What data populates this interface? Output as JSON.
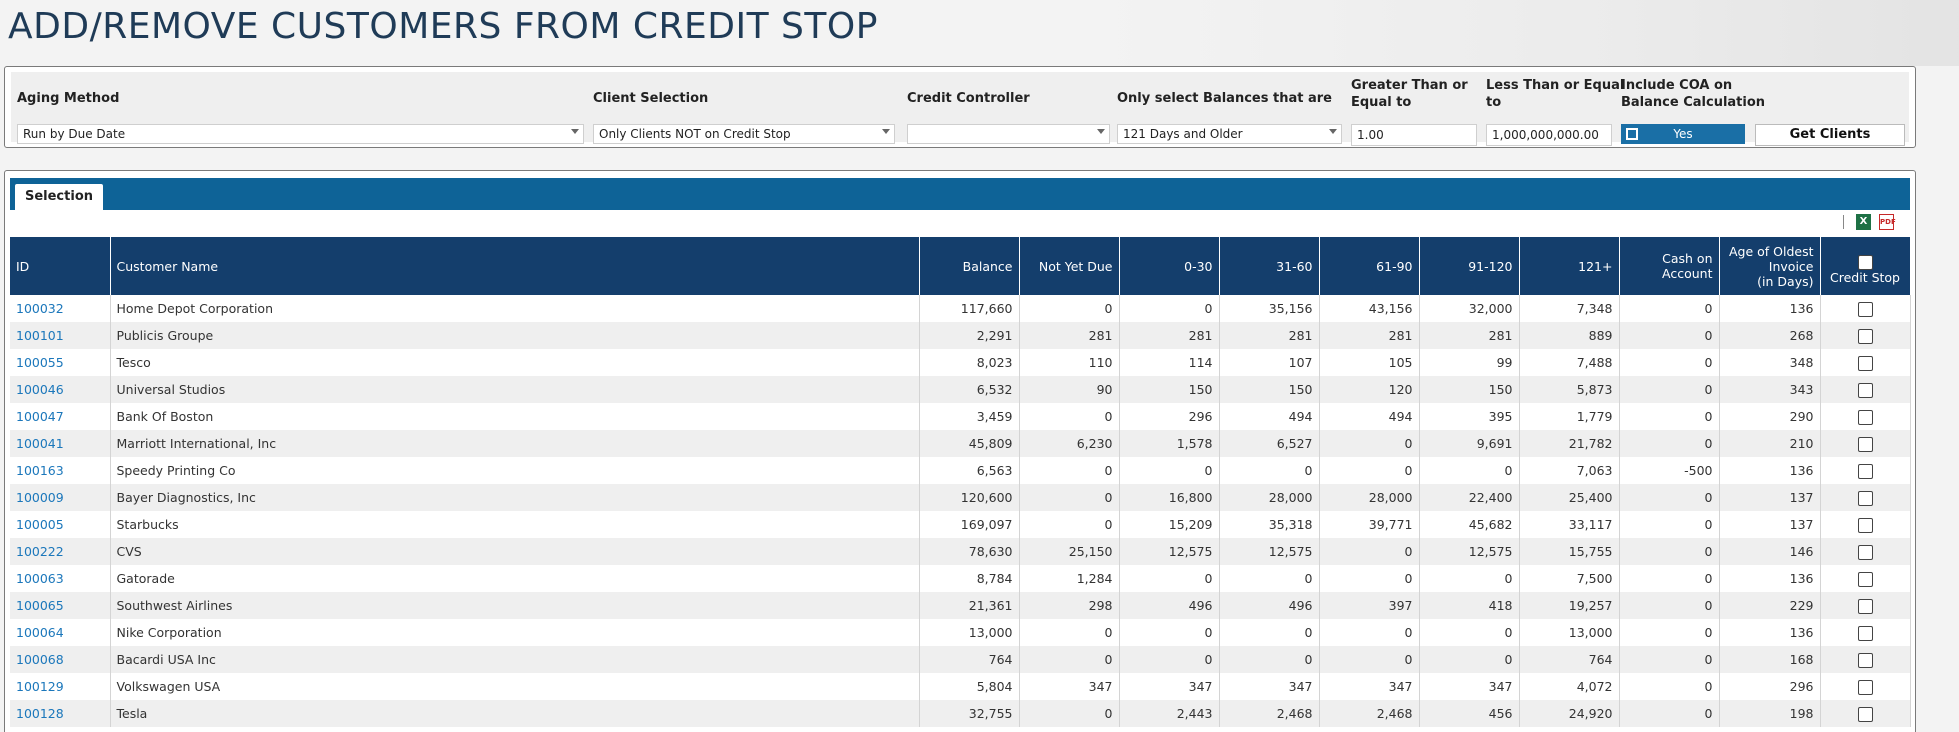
{
  "page": {
    "title": "ADD/REMOVE CUSTOMERS FROM CREDIT STOP"
  },
  "filters": {
    "aging_method": {
      "label": "Aging Method",
      "value": "Run by Due Date"
    },
    "client_selection": {
      "label": "Client Selection",
      "value": "Only Clients NOT on Credit Stop"
    },
    "credit_controller": {
      "label": "Credit Controller",
      "value": ""
    },
    "balances": {
      "label": "Only select Balances that are",
      "value": "121 Days and Older"
    },
    "greater_than": {
      "label_1": "Greater Than or",
      "label_2": "Equal to",
      "value": "1.00"
    },
    "less_than": {
      "label_1": "Less Than or Equal",
      "label_2": "to",
      "value": "1,000,000,000.00"
    },
    "include_coa": {
      "label_1": "Include COA on",
      "label_2": "Balance Calculation",
      "value": "Yes"
    },
    "get_clients_label": "Get Clients"
  },
  "grid": {
    "tab_label": "Selection",
    "icons": {
      "excel": "excel-export-icon",
      "pdf": "pdf-export-icon",
      "excel_glyph": "X",
      "pdf_glyph": "PDF"
    },
    "columns": {
      "id": "ID",
      "name": "Customer Name",
      "balance": "Balance",
      "not_yet_due": "Not Yet Due",
      "b0_30": "0-30",
      "b31_60": "31-60",
      "b61_90": "61-90",
      "b91_120": "91-120",
      "b121": "121+",
      "coa_1": "Cash on",
      "coa_2": "Account",
      "age_1": "Age of Oldest",
      "age_2": "Invoice",
      "age_3": "(in Days)",
      "credit_stop": "Credit Stop"
    },
    "rows": [
      {
        "id": "100032",
        "name": "Home Depot Corporation",
        "balance": "117,660",
        "nyd": "0",
        "b0_30": "0",
        "b31_60": "35,156",
        "b61_90": "43,156",
        "b91_120": "32,000",
        "b121": "7,348",
        "coa": "0",
        "age": "136"
      },
      {
        "id": "100101",
        "name": "Publicis Groupe",
        "balance": "2,291",
        "nyd": "281",
        "b0_30": "281",
        "b31_60": "281",
        "b61_90": "281",
        "b91_120": "281",
        "b121": "889",
        "coa": "0",
        "age": "268"
      },
      {
        "id": "100055",
        "name": "Tesco",
        "balance": "8,023",
        "nyd": "110",
        "b0_30": "114",
        "b31_60": "107",
        "b61_90": "105",
        "b91_120": "99",
        "b121": "7,488",
        "coa": "0",
        "age": "348"
      },
      {
        "id": "100046",
        "name": "Universal Studios",
        "balance": "6,532",
        "nyd": "90",
        "b0_30": "150",
        "b31_60": "150",
        "b61_90": "120",
        "b91_120": "150",
        "b121": "5,873",
        "coa": "0",
        "age": "343"
      },
      {
        "id": "100047",
        "name": "Bank Of Boston",
        "balance": "3,459",
        "nyd": "0",
        "b0_30": "296",
        "b31_60": "494",
        "b61_90": "494",
        "b91_120": "395",
        "b121": "1,779",
        "coa": "0",
        "age": "290"
      },
      {
        "id": "100041",
        "name": "Marriott International, Inc",
        "balance": "45,809",
        "nyd": "6,230",
        "b0_30": "1,578",
        "b31_60": "6,527",
        "b61_90": "0",
        "b91_120": "9,691",
        "b121": "21,782",
        "coa": "0",
        "age": "210"
      },
      {
        "id": "100163",
        "name": "Speedy Printing Co",
        "balance": "6,563",
        "nyd": "0",
        "b0_30": "0",
        "b31_60": "0",
        "b61_90": "0",
        "b91_120": "0",
        "b121": "7,063",
        "coa": "-500",
        "age": "136"
      },
      {
        "id": "100009",
        "name": "Bayer Diagnostics, Inc",
        "balance": "120,600",
        "nyd": "0",
        "b0_30": "16,800",
        "b31_60": "28,000",
        "b61_90": "28,000",
        "b91_120": "22,400",
        "b121": "25,400",
        "coa": "0",
        "age": "137"
      },
      {
        "id": "100005",
        "name": "Starbucks",
        "balance": "169,097",
        "nyd": "0",
        "b0_30": "15,209",
        "b31_60": "35,318",
        "b61_90": "39,771",
        "b91_120": "45,682",
        "b121": "33,117",
        "coa": "0",
        "age": "137"
      },
      {
        "id": "100222",
        "name": "CVS",
        "balance": "78,630",
        "nyd": "25,150",
        "b0_30": "12,575",
        "b31_60": "12,575",
        "b61_90": "0",
        "b91_120": "12,575",
        "b121": "15,755",
        "coa": "0",
        "age": "146"
      },
      {
        "id": "100063",
        "name": "Gatorade",
        "balance": "8,784",
        "nyd": "1,284",
        "b0_30": "0",
        "b31_60": "0",
        "b61_90": "0",
        "b91_120": "0",
        "b121": "7,500",
        "coa": "0",
        "age": "136"
      },
      {
        "id": "100065",
        "name": "Southwest Airlines",
        "balance": "21,361",
        "nyd": "298",
        "b0_30": "496",
        "b31_60": "496",
        "b61_90": "397",
        "b91_120": "418",
        "b121": "19,257",
        "coa": "0",
        "age": "229"
      },
      {
        "id": "100064",
        "name": "Nike Corporation",
        "balance": "13,000",
        "nyd": "0",
        "b0_30": "0",
        "b31_60": "0",
        "b61_90": "0",
        "b91_120": "0",
        "b121": "13,000",
        "coa": "0",
        "age": "136"
      },
      {
        "id": "100068",
        "name": "Bacardi USA Inc",
        "balance": "764",
        "nyd": "0",
        "b0_30": "0",
        "b31_60": "0",
        "b61_90": "0",
        "b91_120": "0",
        "b121": "764",
        "coa": "0",
        "age": "168"
      },
      {
        "id": "100129",
        "name": "Volkswagen USA",
        "balance": "5,804",
        "nyd": "347",
        "b0_30": "347",
        "b31_60": "347",
        "b61_90": "347",
        "b91_120": "347",
        "b121": "4,072",
        "coa": "0",
        "age": "296"
      },
      {
        "id": "100128",
        "name": "Tesla",
        "balance": "32,755",
        "nyd": "0",
        "b0_30": "2,443",
        "b31_60": "2,468",
        "b61_90": "2,468",
        "b91_120": "456",
        "b121": "24,920",
        "coa": "0",
        "age": "198"
      }
    ]
  }
}
